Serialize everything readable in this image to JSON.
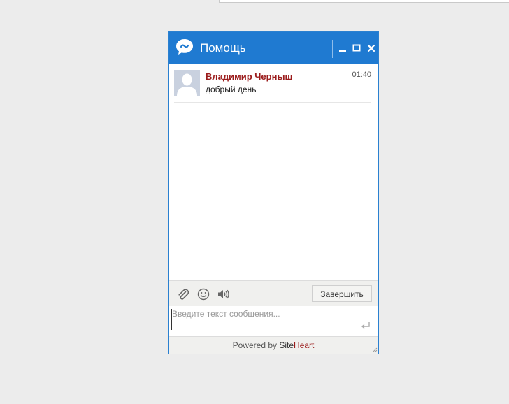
{
  "widget": {
    "title": "Помощь",
    "controls": [
      "minimize-icon",
      "maximize-icon",
      "close-icon"
    ],
    "accent_color": "#1f7ad1"
  },
  "messages": [
    {
      "author": "Владимир Черныш",
      "text": "добрый день",
      "time": "01:40"
    }
  ],
  "toolbar": {
    "icons": [
      "paperclip-icon",
      "smiley-icon",
      "speaker-icon"
    ],
    "finish_label": "Завершить"
  },
  "input": {
    "placeholder": "Введите текст сообщения...",
    "value": ""
  },
  "footer": {
    "powered_by": "Powered by",
    "brand_site": "Site",
    "brand_heart": "Heart"
  }
}
